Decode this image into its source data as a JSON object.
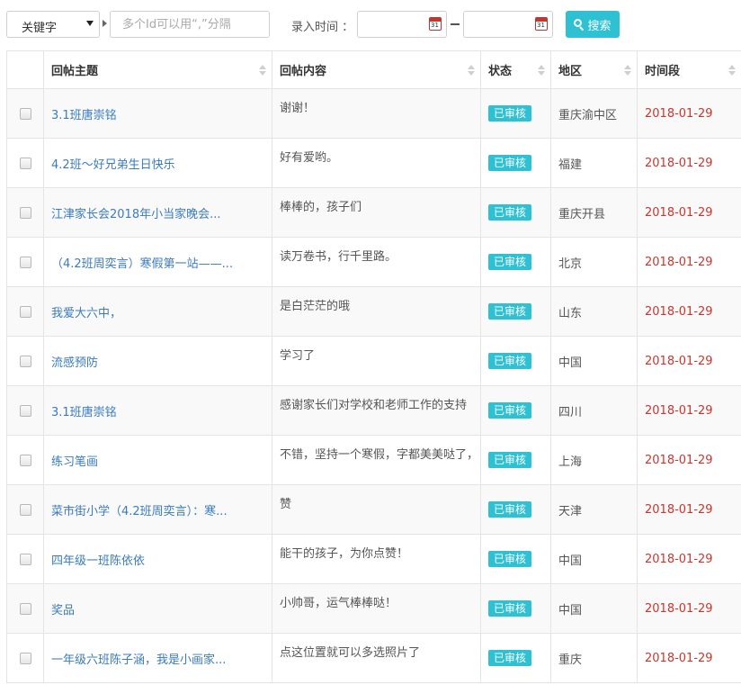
{
  "filter": {
    "keyword_select": "关键字",
    "id_placeholder": "多个Id可以用“,”分隔",
    "date_label": "录入时间 ：",
    "calendar_day": "31",
    "search_label": "搜索"
  },
  "table": {
    "headers": {
      "subject": "回帖主题",
      "content": "回帖内容",
      "status": "状态",
      "region": "地区",
      "time": "时间段"
    },
    "rows": [
      {
        "subject": "3.1班唐崇铭",
        "content": "谢谢！",
        "status": "已审核",
        "region": "重庆渝中区",
        "date": "2018-01-29"
      },
      {
        "subject": "4.2班～好兄弟生日快乐",
        "content": "好有爱哟。",
        "status": "已审核",
        "region": "福建",
        "date": "2018-01-29"
      },
      {
        "subject": "江津家长会2018年小当家晚会...",
        "content": "棒棒的，孩子们",
        "status": "已审核",
        "region": "重庆开县",
        "date": "2018-01-29"
      },
      {
        "subject": "（4.2班周奕言）寒假第一站——...",
        "content": "读万卷书，行千里路。",
        "status": "已审核",
        "region": "北京",
        "date": "2018-01-29"
      },
      {
        "subject": "我爱大六中，",
        "content": "是白茫茫的哦",
        "status": "已审核",
        "region": "山东",
        "date": "2018-01-29"
      },
      {
        "subject": "流感预防",
        "content": "学习了",
        "status": "已审核",
        "region": "中国",
        "date": "2018-01-29"
      },
      {
        "subject": "3.1班唐崇铭",
        "content": "感谢家长们对学校和老师工作的支持",
        "status": "已审核",
        "region": "四川",
        "date": "2018-01-29"
      },
      {
        "subject": "练习笔画",
        "content": "不错，坚持一个寒假，字都美美哒了，",
        "status": "已审核",
        "region": "上海",
        "date": "2018-01-29"
      },
      {
        "subject": "菜市街小学（4.2班周奕言）：寒...",
        "content": "赞",
        "status": "已审核",
        "region": "天津",
        "date": "2018-01-29"
      },
      {
        "subject": "四年级一班陈依依",
        "content": "能干的孩子，为你点赞！",
        "status": "已审核",
        "region": "中国",
        "date": "2018-01-29"
      },
      {
        "subject": "奖品",
        "content": "小帅哥，运气棒棒哒！",
        "status": "已审核",
        "region": "中国",
        "date": "2018-01-29"
      },
      {
        "subject": "一年级六班陈子涵，我是小画家...",
        "content": "点这位置就可以多选照片了",
        "status": "已审核",
        "region": "重庆",
        "date": "2018-01-29"
      }
    ]
  },
  "colors": {
    "accent": "#2ec1d3",
    "link": "#3a7bbf",
    "date": "#d0332b"
  }
}
